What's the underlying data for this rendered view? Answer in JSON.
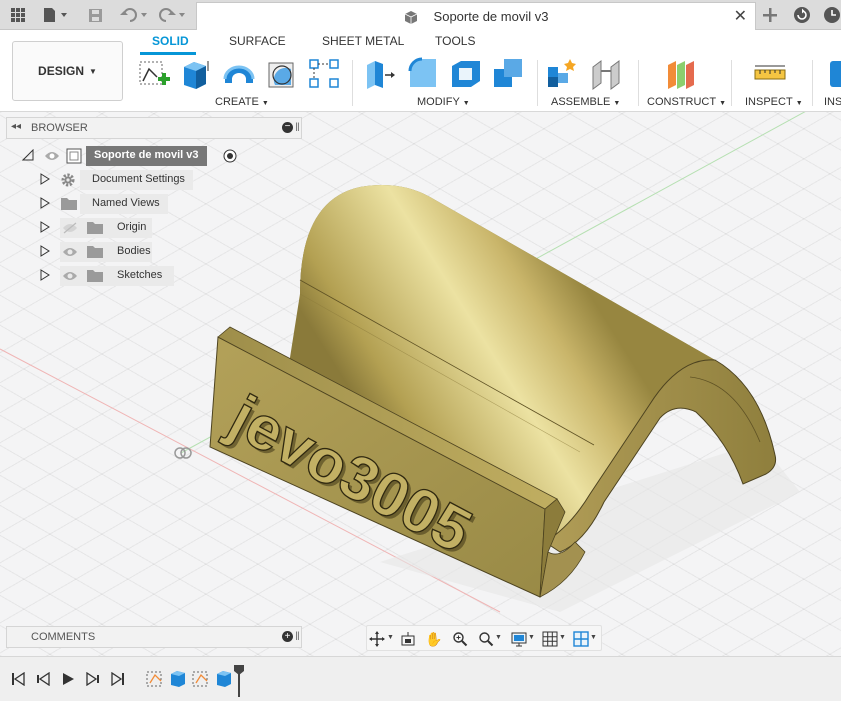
{
  "titlebar": {
    "document_title": "Soporte de movil v3",
    "icons": [
      "grid-icon",
      "file-icon",
      "save-icon",
      "undo-icon",
      "redo-icon",
      "close-icon",
      "new-tab-icon",
      "refresh-icon",
      "clock-icon"
    ]
  },
  "toolbar": {
    "workspace_label": "DESIGN",
    "tabs": [
      "SOLID",
      "SURFACE",
      "SHEET METAL",
      "TOOLS"
    ],
    "active_tab": "SOLID",
    "groups": [
      "CREATE",
      "MODIFY",
      "ASSEMBLE",
      "CONSTRUCT",
      "INSPECT",
      "INSE"
    ]
  },
  "browser": {
    "header": "BROWSER",
    "root": "Soporte de movil v3",
    "items": [
      {
        "label": "Document Settings"
      },
      {
        "label": "Named Views"
      },
      {
        "label": "Origin"
      },
      {
        "label": "Bodies"
      },
      {
        "label": "Sketches"
      }
    ]
  },
  "comments": {
    "header": "COMMENTS"
  },
  "model": {
    "embossed_text": "jevo3005",
    "color": "#b8a24e"
  },
  "navbar": {
    "icons": [
      "orbit-icon",
      "look-at-icon",
      "pan-icon",
      "zoom-icon",
      "zoom-window-icon",
      "display-settings-icon",
      "grid-settings-icon",
      "viewports-icon"
    ]
  },
  "colors": {
    "accent": "#0696d7",
    "model_gold": "#b8a24e"
  }
}
